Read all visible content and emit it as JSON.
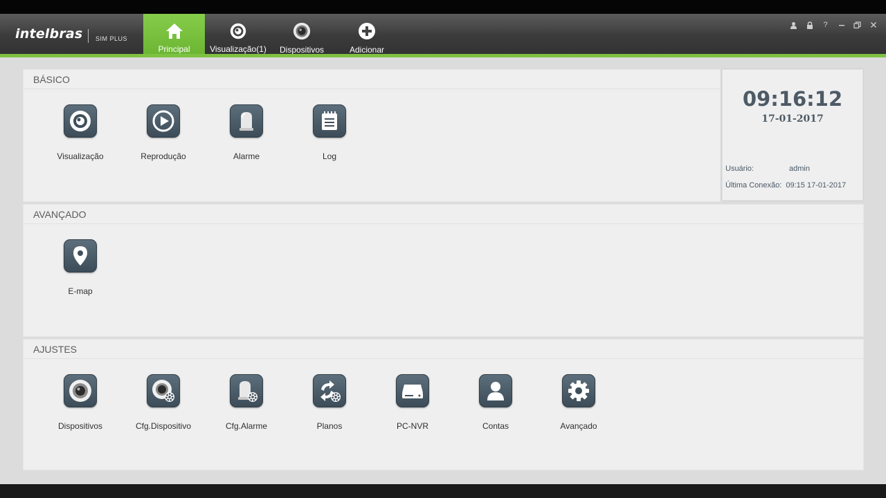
{
  "app": {
    "logo": "intelbras",
    "logo_sub": "SIM PLUS"
  },
  "nav": [
    {
      "label": "Principal",
      "icon": "home-icon",
      "active": true
    },
    {
      "label": "Visualização(1)",
      "icon": "eye-icon",
      "active": false
    },
    {
      "label": "Dispositivos",
      "icon": "camera-icon",
      "active": false
    },
    {
      "label": "Adicionar",
      "icon": "plus-icon",
      "active": false
    }
  ],
  "window_controls": [
    "user-icon",
    "lock-icon",
    "help-icon",
    "minimize-icon",
    "restore-icon",
    "close-icon"
  ],
  "sections": {
    "basico": {
      "title": "BÁSICO",
      "items": [
        {
          "label": "Visualização",
          "icon": "eye-icon"
        },
        {
          "label": "Reprodução",
          "icon": "play-icon"
        },
        {
          "label": "Alarme",
          "icon": "alarm-light-icon"
        },
        {
          "label": "Log",
          "icon": "log-icon"
        }
      ]
    },
    "avancado": {
      "title": "AVANÇADO",
      "items": [
        {
          "label": "E-map",
          "icon": "map-pin-icon"
        }
      ]
    },
    "ajustes": {
      "title": "AJUSTES",
      "items": [
        {
          "label": "Dispositivos",
          "icon": "camera-icon"
        },
        {
          "label": "Cfg.Dispositivo",
          "icon": "camera-settings-icon"
        },
        {
          "label": "Cfg.Alarme",
          "icon": "alarm-settings-icon"
        },
        {
          "label": "Planos",
          "icon": "schedule-settings-icon"
        },
        {
          "label": "PC-NVR",
          "icon": "hard-drive-icon"
        },
        {
          "label": "Contas",
          "icon": "user-icon"
        },
        {
          "label": "Avançado",
          "icon": "gear-icon"
        }
      ]
    }
  },
  "clock": {
    "time": "09:16:12",
    "date": "17-01-2017",
    "user_label": "Usuário:",
    "user_value": "admin",
    "last_conn_label": "Última Conexão:",
    "last_conn_value": "09:15 17-01-2017"
  },
  "colors": {
    "accent": "#7ec242",
    "header": "#3b3b3b",
    "tile": "#4a5a66"
  }
}
